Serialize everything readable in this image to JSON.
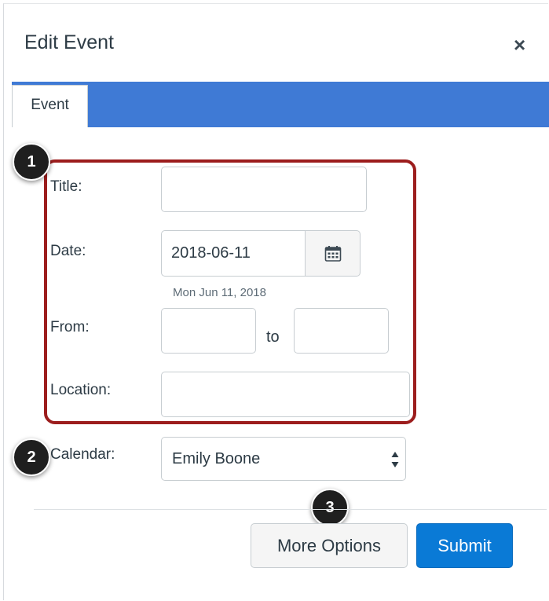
{
  "dialog": {
    "title": "Edit Event",
    "close_label": "×"
  },
  "tabs": [
    {
      "label": "Event"
    }
  ],
  "form": {
    "title_label": "Title:",
    "title_value": "",
    "date_label": "Date:",
    "date_value": "2018-06-11",
    "date_hint": "Mon Jun 11, 2018",
    "from_label": "From:",
    "from_value": "",
    "to_text": "to",
    "to_value": "",
    "location_label": "Location:",
    "location_value": "",
    "calendar_label": "Calendar:",
    "calendar_value": "Emily Boone"
  },
  "buttons": {
    "more_options": "More Options",
    "submit": "Submit"
  },
  "callouts": [
    "1",
    "2",
    "3"
  ],
  "colors": {
    "tab_bar": "#3f7ad5",
    "submit": "#0a7ad6",
    "highlight": "#9c1d1d",
    "callout": "#1f1f1f"
  },
  "icons": {
    "calendar_button": "calendar-icon",
    "select_arrows": "sort-arrows-icon",
    "close": "close-icon"
  }
}
